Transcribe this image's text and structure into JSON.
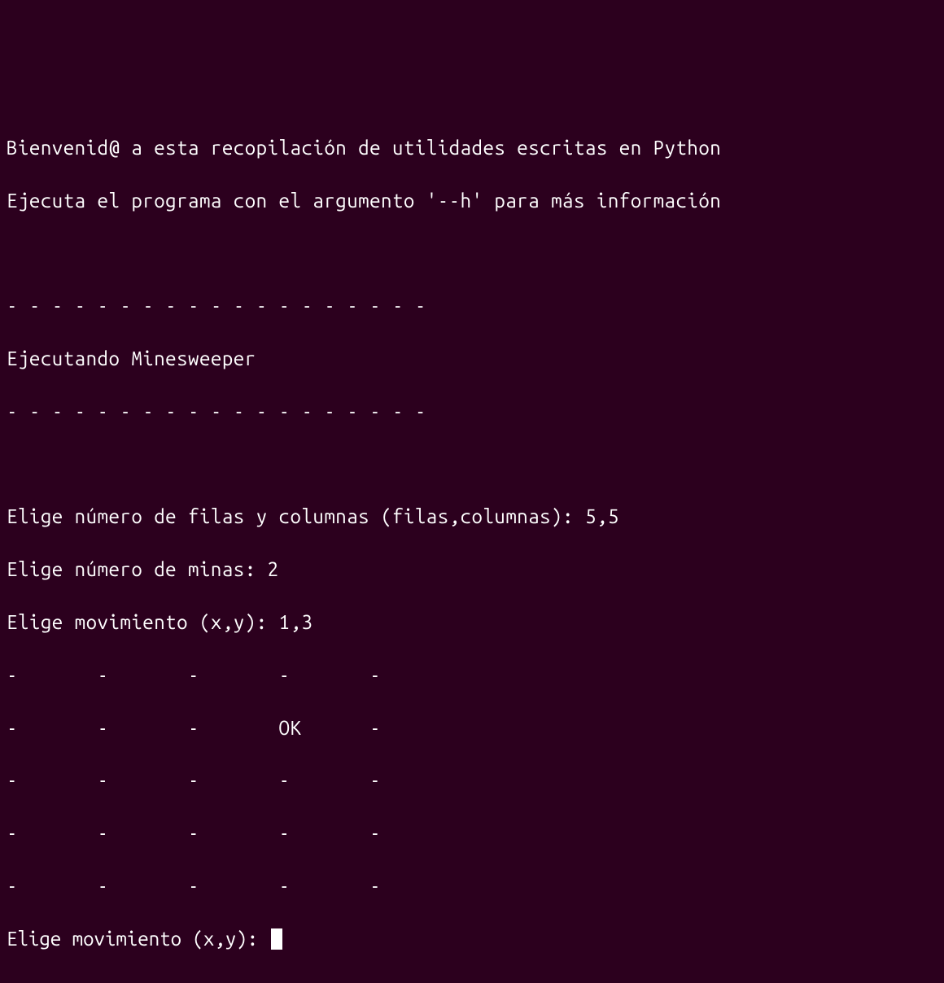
{
  "terminal": {
    "lines": {
      "welcome1": "Bienvenid@ a esta recopilación de utilidades escritas en Python",
      "welcome2": "Ejecuta el programa con el argumento '--h' para más información",
      "blank": "",
      "sep1": "- - - - - - - - - - - - - - - - - - -",
      "running": "Ejecutando Minesweeper",
      "sep2": "- - - - - - - - - - - - - - - - - - -",
      "prompt_rows_cols": "Elige número de filas y columnas (filas,columnas): 5,5",
      "prompt_mines": "Elige número de minas: 2",
      "prompt_move1": "Elige movimiento (x,y): 1,3",
      "grid_row_0": "-       -       -       -       -",
      "grid_row_1": "-       -       -       OK      -",
      "grid_row_2": "-       -       -       -       -",
      "grid_row_3": "-       -       -       -       -",
      "grid_row_4": "-       -       -       -       -",
      "prompt_current": "Elige movimiento (x,y): "
    }
  },
  "game": {
    "rows": 5,
    "cols": 5,
    "mines": 2,
    "last_move": "1,3",
    "grid": [
      [
        "-",
        "-",
        "-",
        "-",
        "-"
      ],
      [
        "-",
        "-",
        "-",
        "OK",
        "-"
      ],
      [
        "-",
        "-",
        "-",
        "-",
        "-"
      ],
      [
        "-",
        "-",
        "-",
        "-",
        "-"
      ],
      [
        "-",
        "-",
        "-",
        "-",
        "-"
      ]
    ]
  },
  "colors": {
    "background": "#2c001e",
    "foreground": "#ffffff"
  }
}
